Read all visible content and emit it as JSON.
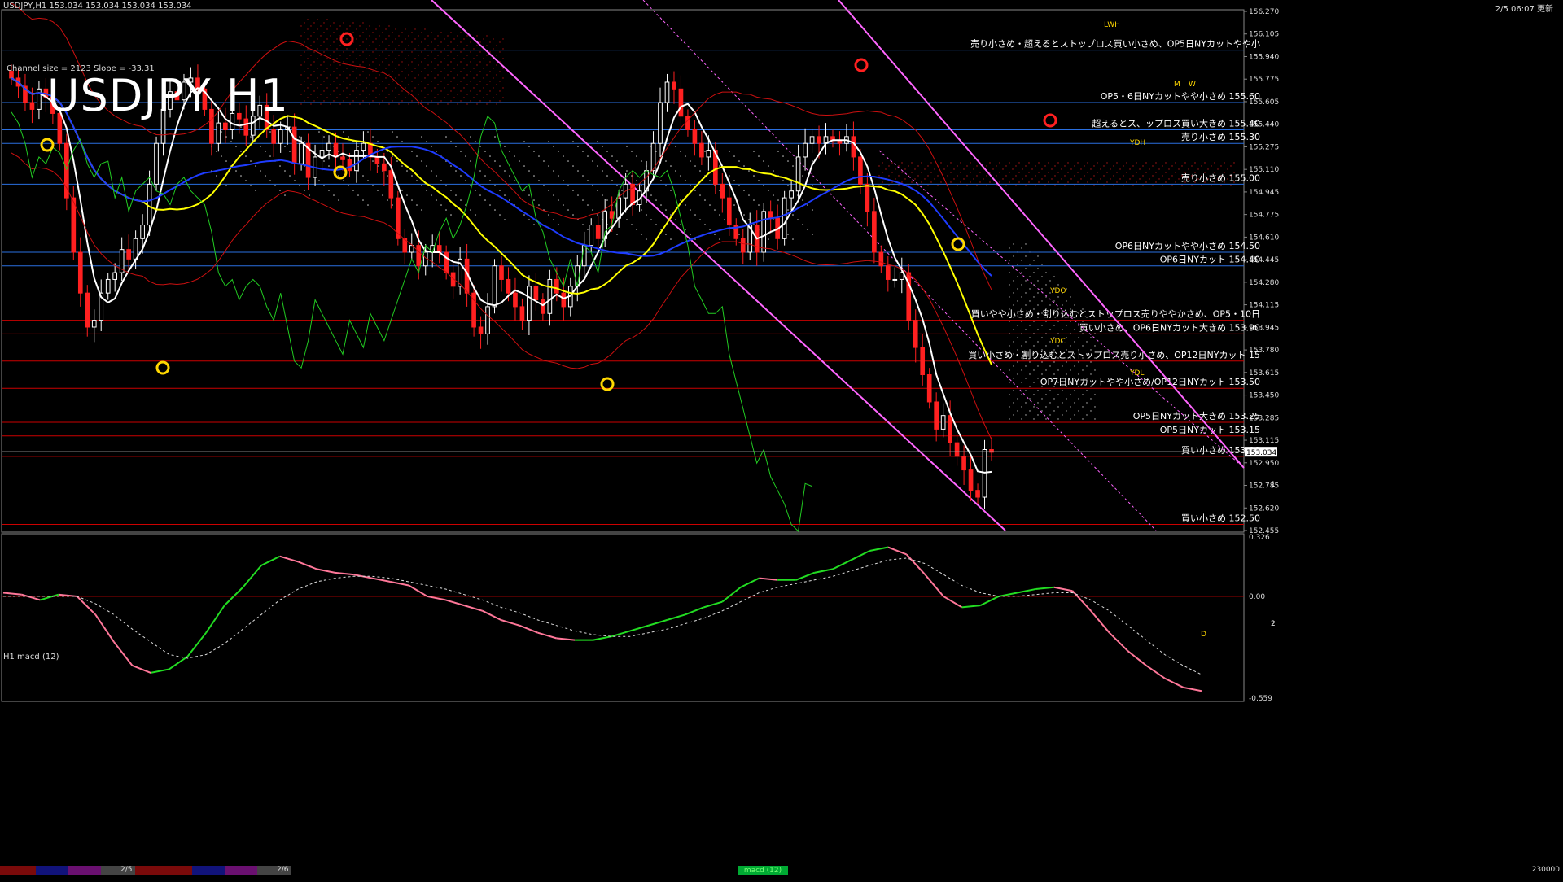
{
  "header": {
    "symbol_info": "USDJPY,H1 153.034 153.034 153.034 153.034",
    "update": "2/5 06:07 更新"
  },
  "big_title": "USDJPY H1",
  "channel_label": "Channel size = 2123 Slope = -33.31",
  "colors": {
    "up": "#ffffff",
    "down": "#ff2020",
    "bg": "#000000",
    "ma_white": "#ffffff",
    "ma_yellow": "#ffff00",
    "ma_blue": "#1e3cff",
    "chikou": "#22cc22",
    "band": "#cc1010",
    "channel": "#ff66ff",
    "hline_blue": "#2a6fe0",
    "hline_red": "#cc0000"
  },
  "chart_data": {
    "type": "candlestick",
    "symbol": "USDJPY",
    "timeframe": "H1",
    "ylim": [
      152.455,
      156.27
    ],
    "y_ticks": [
      "156.270",
      "156.105",
      "155.940",
      "155.775",
      "155.605",
      "155.440",
      "155.275",
      "155.110",
      "154.945",
      "154.775",
      "154.610",
      "154.445",
      "154.280",
      "154.115",
      "153.945",
      "153.780",
      "153.615",
      "153.450",
      "153.285",
      "153.115",
      "152.950",
      "152.785",
      "152.620",
      "152.455"
    ],
    "current_price": "153.034",
    "date_labels": [
      "2/5",
      "2/6"
    ],
    "key_levels": [
      {
        "price": 155.985,
        "label": "売り小さめ・超えるとストップロス買い小さめ、OP5日NYカットやや小",
        "color": "blue"
      },
      {
        "price": 155.6,
        "label": "OP5・6日NYカットやや小さめ 155.60",
        "color": "blue"
      },
      {
        "price": 155.4,
        "label": "超えるとス、ップロス買い大きめ 155.40",
        "color": "blue"
      },
      {
        "price": 155.3,
        "label": "売り小さめ 155.30",
        "color": "blue"
      },
      {
        "price": 155.0,
        "label": "売り小さめ 155.00",
        "color": "blue"
      },
      {
        "price": 154.5,
        "label": "OP6日NYカットやや小さめ 154.50",
        "color": "blue"
      },
      {
        "price": 154.4,
        "label": "OP6日NYカット 154.40",
        "color": "blue"
      },
      {
        "price": 154.0,
        "label": "買いやや小さめ・割り込むとストップロス売りややかさめ、OP5・10日",
        "color": "red"
      },
      {
        "price": 153.9,
        "label": "買い小さめ、OP6日NYカット大きめ 153.90",
        "color": "red"
      },
      {
        "price": 153.7,
        "label": "買い小さめ・割り込むとストップロス売り小さめ、OP12日NYカット 15",
        "color": "red"
      },
      {
        "price": 153.5,
        "label": "OP7日NYカットやや小さめ/OP12日NYカット 153.50",
        "color": "red"
      },
      {
        "price": 153.25,
        "label": "OP5日NYカット大きめ 153.25",
        "color": "red"
      },
      {
        "price": 153.15,
        "label": "OP5日NYカット 153.15",
        "color": "red"
      },
      {
        "price": 153.0,
        "label": "買い小さめ 153.00",
        "color": "red"
      },
      {
        "price": 152.5,
        "label": "買い小さめ 152.50",
        "color": "red"
      }
    ],
    "markers": [
      "LWH",
      "YDH",
      "YDO",
      "YDC",
      "YDL",
      "M",
      "W",
      "D",
      "1",
      "2"
    ],
    "closes": [
      155.78,
      155.72,
      155.6,
      155.55,
      155.7,
      155.64,
      155.52,
      155.3,
      154.9,
      154.5,
      154.2,
      153.95,
      154.0,
      154.2,
      154.3,
      154.35,
      154.52,
      154.45,
      154.6,
      154.7,
      155.0,
      155.3,
      155.55,
      155.68,
      155.62,
      155.75,
      155.78,
      155.7,
      155.55,
      155.3,
      155.45,
      155.4,
      155.52,
      155.48,
      155.36,
      155.5,
      155.58,
      155.4,
      155.3,
      155.4,
      155.42,
      155.15,
      155.3,
      155.05,
      155.2,
      155.25,
      155.3,
      155.2,
      155.18,
      155.1,
      155.25,
      155.3,
      155.2,
      155.15,
      155.1,
      154.9,
      154.6,
      154.5,
      154.55,
      154.4,
      154.5,
      154.55,
      154.5,
      154.35,
      154.25,
      154.45,
      154.2,
      153.95,
      153.9,
      154.1,
      154.4,
      154.3,
      154.2,
      154.1,
      154.0,
      154.25,
      154.15,
      154.05,
      154.3,
      154.2,
      154.1,
      154.25,
      154.4,
      154.55,
      154.7,
      154.6,
      154.8,
      154.75,
      154.9,
      155.0,
      154.85,
      154.95,
      155.1,
      155.3,
      155.6,
      155.75,
      155.7,
      155.5,
      155.4,
      155.3,
      155.2,
      155.25,
      155.0,
      154.9,
      154.7,
      154.6,
      154.5,
      154.7,
      154.5,
      154.8,
      154.75,
      154.6,
      154.9,
      154.95,
      155.2,
      155.3,
      155.35,
      155.3,
      155.35,
      155.32,
      155.3,
      155.35,
      155.2,
      155.0,
      154.8,
      154.5,
      154.4,
      154.3,
      154.3,
      154.35,
      154.0,
      153.8,
      153.6,
      153.4,
      153.2,
      153.3,
      153.1,
      153.0,
      152.9,
      152.75,
      152.7,
      153.05,
      153.03
    ],
    "macd_panel": {
      "label": "H1 macd (12)",
      "y_ticks": [
        "0.326",
        "0.00",
        "-0.559"
      ],
      "ylim": [
        -0.559,
        0.326
      ],
      "macd": [
        0.02,
        0.01,
        -0.02,
        0.01,
        0.0,
        -0.1,
        -0.25,
        -0.38,
        -0.42,
        -0.4,
        -0.33,
        -0.2,
        -0.05,
        0.05,
        0.17,
        0.22,
        0.19,
        0.15,
        0.13,
        0.12,
        0.1,
        0.08,
        0.06,
        0.0,
        -0.02,
        -0.05,
        -0.08,
        -0.13,
        -0.16,
        -0.2,
        -0.23,
        -0.24,
        -0.24,
        -0.22,
        -0.19,
        -0.16,
        -0.13,
        -0.1,
        -0.06,
        -0.03,
        0.05,
        0.1,
        0.09,
        0.09,
        0.13,
        0.15,
        0.2,
        0.25,
        0.27,
        0.23,
        0.12,
        0.0,
        -0.06,
        -0.05,
        0.0,
        0.02,
        0.04,
        0.05,
        0.03,
        -0.08,
        -0.2,
        -0.3,
        -0.38,
        -0.45,
        -0.5,
        -0.52
      ],
      "signal": [
        0.0,
        0.0,
        0.0,
        0.0,
        0.0,
        -0.04,
        -0.1,
        -0.18,
        -0.25,
        -0.32,
        -0.34,
        -0.32,
        -0.26,
        -0.18,
        -0.1,
        -0.02,
        0.04,
        0.08,
        0.1,
        0.11,
        0.11,
        0.1,
        0.08,
        0.06,
        0.04,
        0.01,
        -0.02,
        -0.06,
        -0.09,
        -0.13,
        -0.16,
        -0.19,
        -0.21,
        -0.22,
        -0.22,
        -0.2,
        -0.18,
        -0.15,
        -0.12,
        -0.08,
        -0.03,
        0.02,
        0.05,
        0.07,
        0.09,
        0.11,
        0.14,
        0.17,
        0.2,
        0.21,
        0.18,
        0.12,
        0.06,
        0.02,
        0.0,
        0.0,
        0.01,
        0.02,
        0.02,
        -0.02,
        -0.08,
        -0.16,
        -0.24,
        -0.32,
        -0.38,
        -0.43
      ]
    }
  },
  "status_bar": {
    "dates": [
      "2/5",
      "2/6"
    ],
    "tab": "macd (12)",
    "volume": "230000"
  }
}
